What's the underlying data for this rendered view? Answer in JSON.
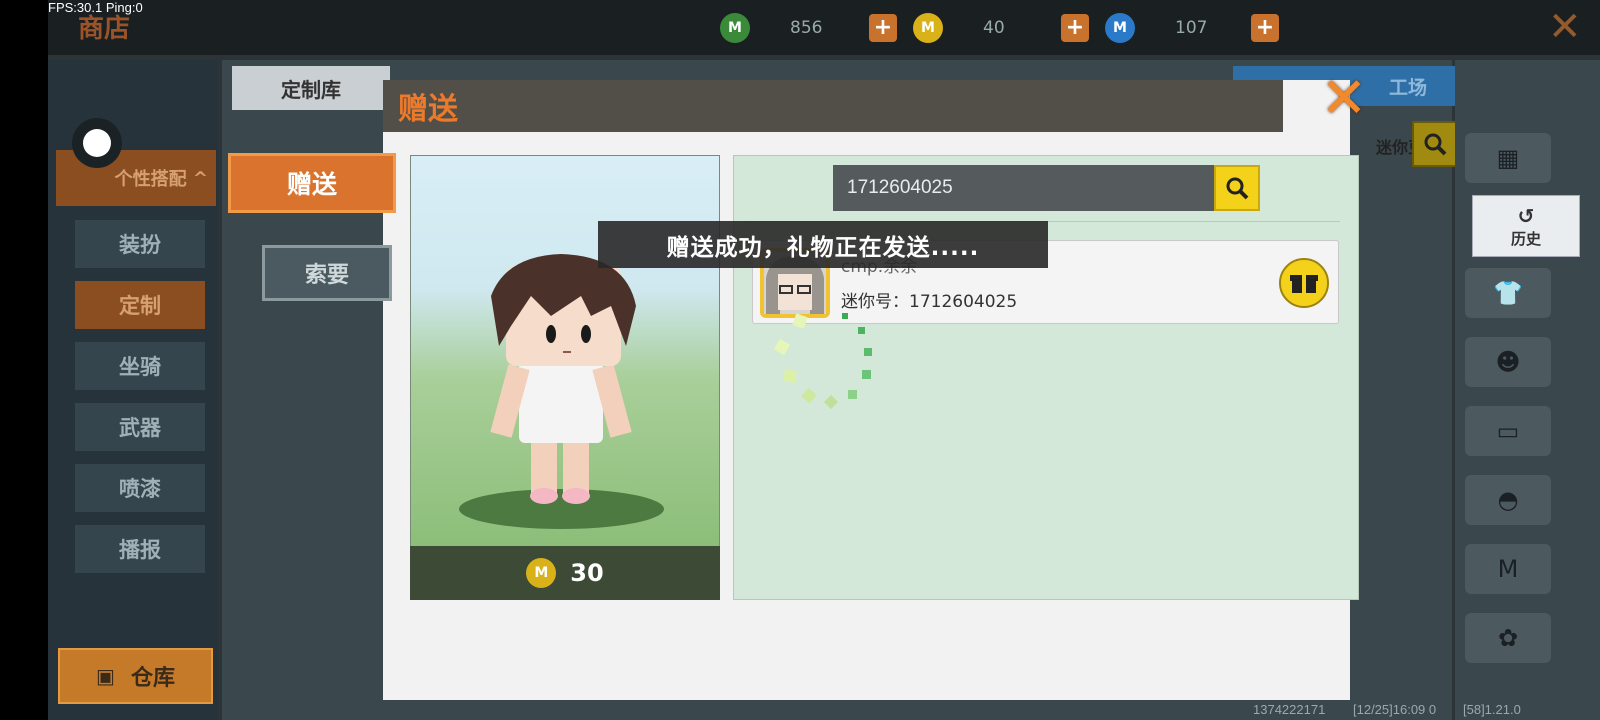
{
  "status": {
    "fps": "FPS:30.1",
    "ping": "Ping:0"
  },
  "shop": {
    "title": "商店"
  },
  "currencies": [
    {
      "icon": "mini-bean-icon",
      "value": "856"
    },
    {
      "icon": "mini-coin-icon",
      "value": "40"
    },
    {
      "icon": "star-coin-icon",
      "value": "107"
    }
  ],
  "side_menu": {
    "header": "个性搭配",
    "items": [
      {
        "label": "装扮"
      },
      {
        "label": "定制"
      },
      {
        "label": "坐骑"
      },
      {
        "label": "武器"
      },
      {
        "label": "喷漆"
      },
      {
        "label": "播报"
      }
    ],
    "warehouse": "仓库"
  },
  "main_tabs": {
    "library": "定制库",
    "workshop": "工场",
    "mini_bean": "迷你豆"
  },
  "right_panel": {
    "history": "历史"
  },
  "dialog": {
    "title": "赠送",
    "tabs": {
      "give": "赠送",
      "ask": "索要"
    },
    "price": "30",
    "search": {
      "value": "1712604025"
    },
    "user": {
      "name": "cmp.余余",
      "id_label": "迷你号：",
      "id_value": "1712604025"
    },
    "toast": "赠送成功，礼物正在发送....."
  },
  "footer": {
    "uid": "1374222171",
    "time": "[12/25]16:09 0",
    "version": "[58]1.21.0"
  },
  "colors": {
    "accent": "#ec7a2b",
    "search_yellow": "#f5d21a",
    "panel_green": "#d3e8d8"
  }
}
